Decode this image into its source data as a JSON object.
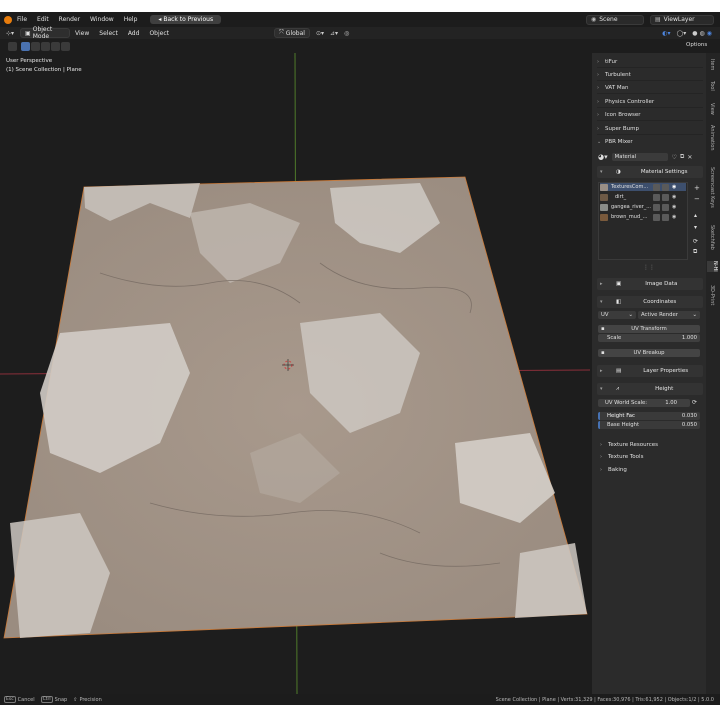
{
  "menu": {
    "items": [
      "File",
      "Edit",
      "Render",
      "Window",
      "Help"
    ],
    "back_button": "Back to Previous",
    "scene": "Scene",
    "view_layer": "ViewLayer"
  },
  "header": {
    "mode": "Object Mode",
    "menus": [
      "View",
      "Select",
      "Add",
      "Object"
    ],
    "transform_orientation": "Global",
    "options": "Options"
  },
  "viewport": {
    "perspective": "User Perspective",
    "collection": "(1) Scene Collection | Plane"
  },
  "panel": {
    "addons": [
      "tiFur",
      "Turbulent",
      "VAT Man",
      "Physics Controller",
      "Icon Browser",
      "Super Bump",
      "PBR Mixer"
    ],
    "material_name": "Material",
    "material_settings": "Material Settings",
    "textures": [
      "TexturesCom...",
      "dirt_",
      "gangea_river_...",
      "brown_mud_..."
    ],
    "texture_colors": [
      "#9a8f86",
      "#6e5a46",
      "#8a8c88",
      "#7a5a3c"
    ],
    "image_data": "Image Data",
    "coordinates": "Coordinates",
    "uv_label": "UV",
    "active_render": "Active Render",
    "uv_transform": "UV Transform",
    "scale_label": "Scale",
    "scale_value": "1.000",
    "uv_breakup": "UV Breakup",
    "layer_properties": "Layer Properties",
    "height": "Height",
    "uv_world_scale_label": "UV World Scale:",
    "uv_world_scale_value": "1.00",
    "height_fac_label": "Height Fac",
    "height_fac_value": "0.030",
    "base_height_label": "Base Height",
    "base_height_value": "0.050",
    "texture_resources": "Texture Resources",
    "texture_tools": "Texture Tools",
    "baking": "Baking"
  },
  "tabs": [
    "Item",
    "Tool",
    "View",
    "Animation",
    "Screencast Keys",
    "Sketchfab",
    "N-Hi",
    "3D-Print"
  ],
  "status": {
    "cancel": "Cancel",
    "cancel_key": "Esc",
    "snap": "Snap",
    "snap_key": "Ctrl",
    "precision": "Precision",
    "stats": "Scene Collection | Plane | Verts:31,329 | Faces:30,976 | Tris:61,952 | Objects:1/2 | 5.0.0"
  }
}
